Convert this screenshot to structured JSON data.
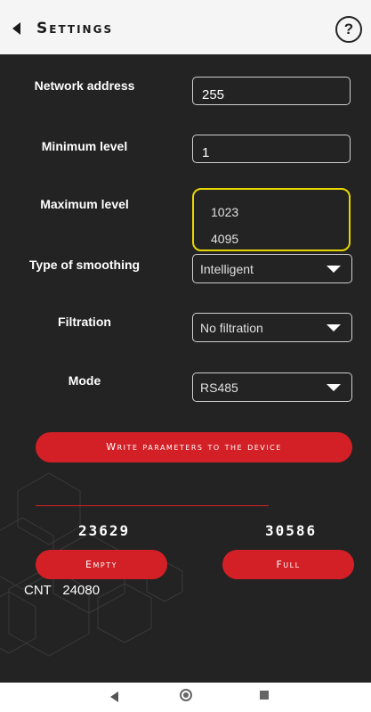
{
  "header": {
    "title": "Settings"
  },
  "form": {
    "network_address": {
      "label": "Network address",
      "value": "255"
    },
    "minimum_level": {
      "label": "Minimum level",
      "value": "1"
    },
    "maximum_level": {
      "label": "Maximum level",
      "options": [
        "1023",
        "4095"
      ]
    },
    "type_of_smoothing": {
      "label": "Type of smoothing",
      "value": "Intelligent"
    },
    "filtration": {
      "label": "Filtration",
      "value": "No filtration"
    },
    "mode": {
      "label": "Mode",
      "value": "RS485"
    }
  },
  "actions": {
    "write_label": "Write parameters to the device"
  },
  "calibration": {
    "empty_value": "23629",
    "full_value": "30586",
    "empty_label": "Empty",
    "full_label": "Full"
  },
  "counter": {
    "label": "CNT",
    "value": "24080"
  },
  "colors": {
    "background": "#232323",
    "accent": "#d32026",
    "highlight": "#e6d600"
  }
}
